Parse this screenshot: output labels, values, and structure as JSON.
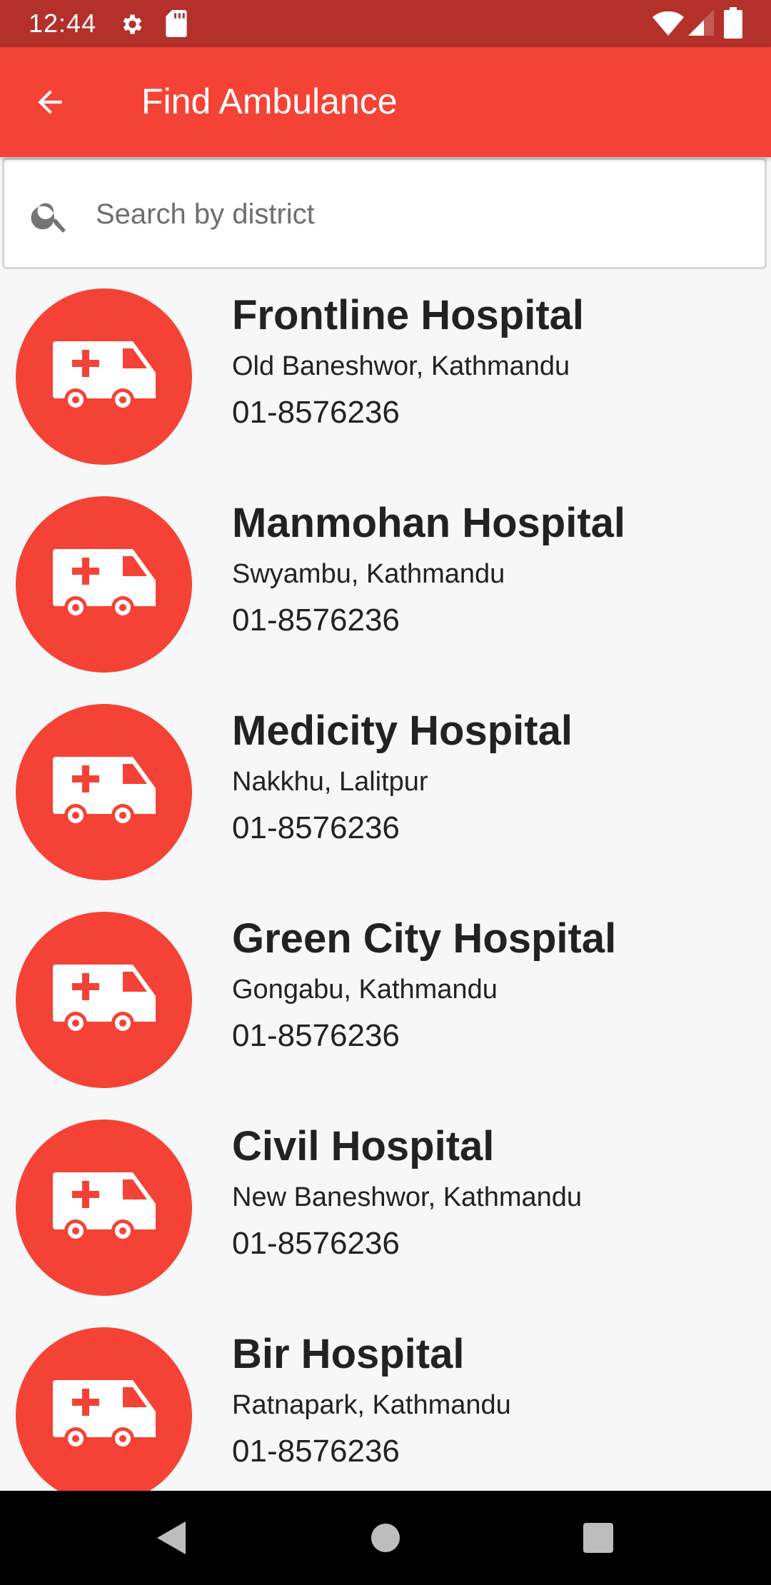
{
  "status_bar": {
    "time": "12:44",
    "icons": [
      "gear-icon",
      "sd-card-icon",
      "wifi-icon",
      "signal-icon",
      "battery-icon"
    ]
  },
  "app_bar": {
    "title": "Find Ambulance",
    "back_icon": "arrow-back-icon"
  },
  "search": {
    "placeholder": "Search by district",
    "value": "",
    "icon": "search-icon"
  },
  "hospitals": [
    {
      "name": "Frontline Hospital",
      "address": "Old Baneshwor, Kathmandu",
      "phone": "01-8576236"
    },
    {
      "name": "Manmohan Hospital",
      "address": "Swyambu, Kathmandu",
      "phone": "01-8576236"
    },
    {
      "name": "Medicity Hospital",
      "address": "Nakkhu, Lalitpur",
      "phone": "01-8576236"
    },
    {
      "name": "Green City Hospital",
      "address": "Gongabu, Kathmandu",
      "phone": "01-8576236"
    },
    {
      "name": "Civil Hospital",
      "address": "New Baneshwor, Kathmandu",
      "phone": "01-8576236"
    },
    {
      "name": "Bir Hospital",
      "address": "Ratnapark, Kathmandu",
      "phone": "01-8576236"
    }
  ],
  "nav_bar": {
    "buttons": [
      "back-triangle-icon",
      "home-circle-icon",
      "recents-square-icon"
    ]
  },
  "colors": {
    "primary": "#f44336",
    "status_bar": "#b3302b",
    "background": "#f7f7f7",
    "text": "#222222"
  }
}
